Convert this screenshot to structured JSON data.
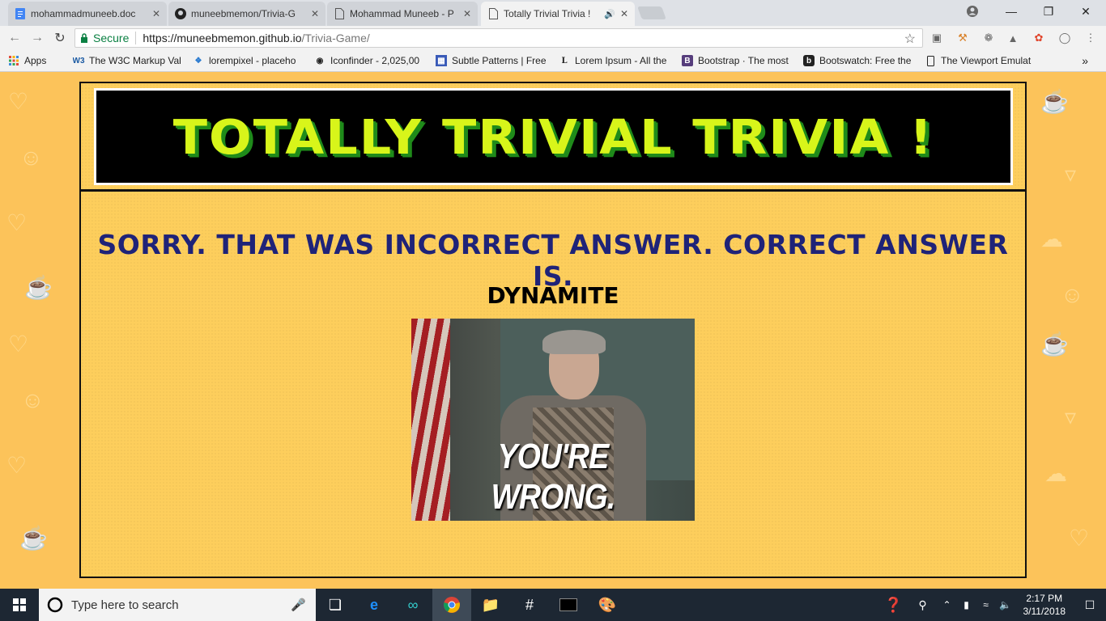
{
  "tabs": [
    {
      "label": "mohammadmuneeb.doc",
      "icon": "docs-icon"
    },
    {
      "label": "muneebmemon/Trivia-G",
      "icon": "github-icon"
    },
    {
      "label": "Mohammad Muneeb - P",
      "icon": "page-icon"
    },
    {
      "label": "Totally Trivial Trivia !",
      "icon": "page-icon",
      "active": true
    }
  ],
  "tab_close": "✕",
  "omnibox": {
    "secure_label": "Secure",
    "url_host": "https://muneebmemon.github.io",
    "url_path": "/Trivia-Game/"
  },
  "bookmarks": [
    {
      "label": "Apps"
    },
    {
      "label": "The W3C Markup Val"
    },
    {
      "label": "lorempixel - placeho"
    },
    {
      "label": "Iconfinder - 2,025,00"
    },
    {
      "label": "Subtle Patterns | Free"
    },
    {
      "label": "Lorem Ipsum - All the"
    },
    {
      "label": "Bootstrap · The most"
    },
    {
      "label": "Bootswatch: Free the"
    },
    {
      "label": "The Viewport Emulat"
    }
  ],
  "bookmarks_overflow": "»",
  "page": {
    "title": "TOTALLY TRIVIAL TRIVIA !",
    "message": "SORRY. THAT WAS INCORRECT ANSWER. CORRECT ANSWER IS.",
    "correct_answer": "DYNAMITE",
    "gif_caption": "YOU'RE WRONG."
  },
  "taskbar": {
    "search_placeholder": "Type here to search",
    "time": "2:17 PM",
    "date": "3/11/2018"
  },
  "colors": {
    "page_bg": "#fcc35a",
    "title_text": "#d8f51a",
    "title_shadow": "#1f8b1a",
    "message_text": "#1f2378",
    "secure_green": "#0b8043"
  }
}
